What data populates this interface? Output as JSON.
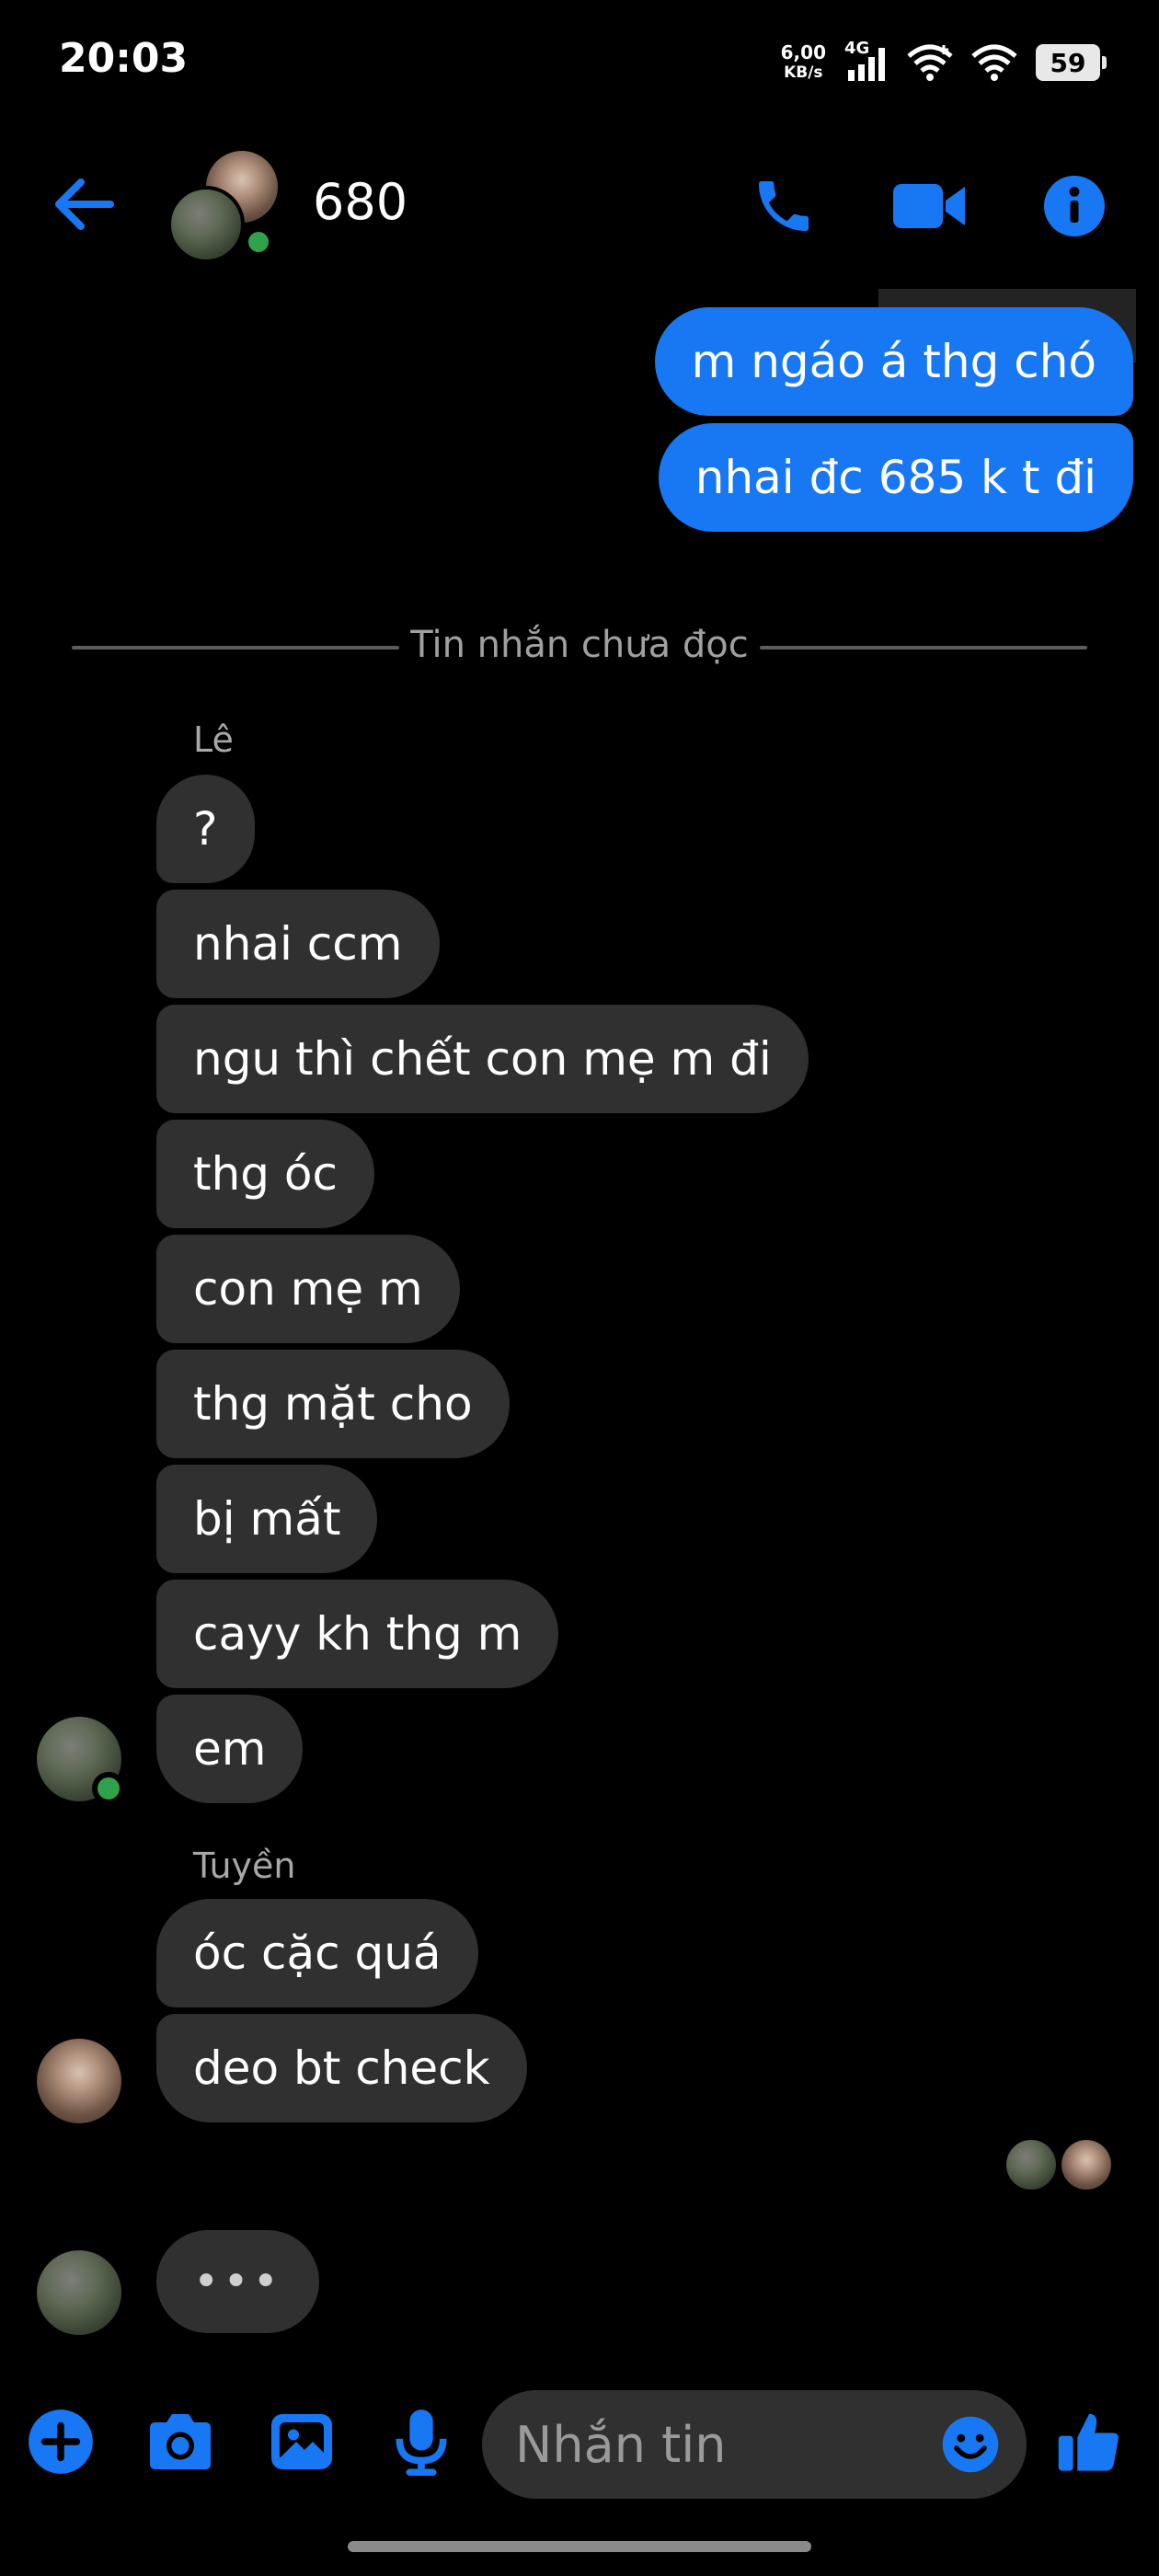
{
  "status_bar": {
    "time": "20:03",
    "net_speed_value": "6,00",
    "net_speed_unit": "KB/s",
    "network_type": "4G",
    "battery": "59"
  },
  "header": {
    "title": "680"
  },
  "outgoing": [
    {
      "text": "m ngáo á thg chó"
    },
    {
      "text": "nhai đc 685 k t đi"
    }
  ],
  "divider": {
    "label": "Tin nhắn chưa đọc"
  },
  "groups": [
    {
      "sender": "Lê",
      "messages": [
        "?",
        "nhai ccm",
        "ngu thì chết con mẹ m đi",
        "thg óc",
        "con mẹ m",
        "thg mặt cho",
        "bị mất",
        "cayy kh thg m",
        "em"
      ]
    },
    {
      "sender": "Tuyền",
      "messages": [
        "óc cặc quá",
        "deo bt check"
      ]
    }
  ],
  "typing_indicator": "•••",
  "composer": {
    "placeholder": "Nhắn tin"
  },
  "colors": {
    "accent": "#1877f2",
    "incoming_bubble": "#303030",
    "online": "#31a24c",
    "background": "#000000"
  },
  "icons": [
    "back-arrow-icon",
    "phone-icon",
    "video-camera-icon",
    "info-icon",
    "plus-icon",
    "camera-icon",
    "gallery-icon",
    "microphone-icon",
    "emoji-icon",
    "thumbs-up-icon"
  ]
}
